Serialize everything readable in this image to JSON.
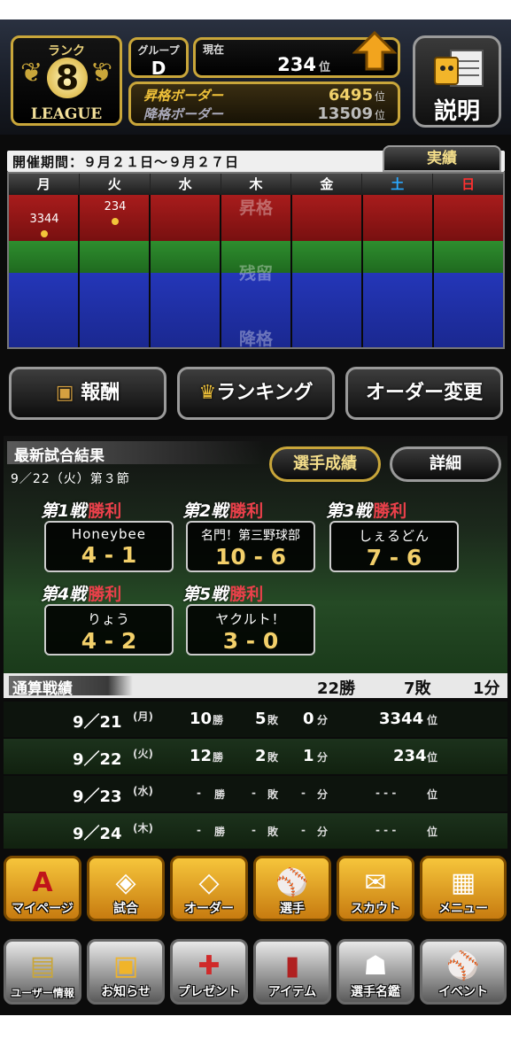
{
  "rank": {
    "label": "ランク",
    "number": "8",
    "league": "LEAGUE"
  },
  "group": {
    "label": "グループ",
    "value": "D"
  },
  "current": {
    "label": "現在",
    "value": "234",
    "unit": "位"
  },
  "promotion": {
    "label": "昇格ボーダー",
    "value": "6495",
    "unit": "位"
  },
  "demotion": {
    "label": "降格ボーダー",
    "value": "13509",
    "unit": "位"
  },
  "help_button": {
    "label": "説明",
    "icon": "league-book-icon"
  },
  "period": {
    "text": "開催期間：９月２１日〜９月２７日"
  },
  "performance_button": "実績",
  "calendar": {
    "days": [
      "月",
      "火",
      "水",
      "木",
      "金",
      "土",
      "日"
    ],
    "zones": {
      "promote": "昇格",
      "stay": "残留",
      "demote": "降格"
    },
    "values": [
      {
        "day": "月",
        "rank": "3344"
      },
      {
        "day": "火",
        "rank": "234"
      }
    ],
    "colors": {
      "promote": "#a81c1c",
      "stay": "#2e8e2e",
      "demote": "#2436b8",
      "saturday": "#2aa8ff",
      "sunday": "#ff3030"
    }
  },
  "nav": {
    "reward": "報酬",
    "ranking": "ランキング",
    "order_change": "オーダー変更"
  },
  "results": {
    "title": "最新試合結果",
    "date": "9／22（火）第３節",
    "player_stats_button": "選手成績",
    "detail_button": "詳細",
    "games": [
      {
        "num": "第1戦",
        "result": "勝利",
        "opponent": "Honeybee",
        "score": "4 - 1"
      },
      {
        "num": "第2戦",
        "result": "勝利",
        "opponent": "名門！第三野球部",
        "score": "10 - 6"
      },
      {
        "num": "第3戦",
        "result": "勝利",
        "opponent": "しぇるどん",
        "score": "7 - 6"
      },
      {
        "num": "第4戦",
        "result": "勝利",
        "opponent": "りょう",
        "score": "4 - 2"
      },
      {
        "num": "第5戦",
        "result": "勝利",
        "opponent": "ヤクルト！",
        "score": "3 - 0"
      }
    ]
  },
  "totals": {
    "label": "通算戦績",
    "wins": "22勝",
    "losses": "7敗",
    "draws": "1分"
  },
  "history": [
    {
      "date": "9／21",
      "dow": "(月)",
      "w": "10",
      "l": "5",
      "d": "0",
      "rank": "3344"
    },
    {
      "date": "9／22",
      "dow": "(火)",
      "w": "12",
      "l": "2",
      "d": "1",
      "rank": "234"
    },
    {
      "date": "9／23",
      "dow": "(水)",
      "w": "-",
      "l": "-",
      "d": "-",
      "rank": "- - -"
    },
    {
      "date": "9／24",
      "dow": "(木)",
      "w": "-",
      "l": "-",
      "d": "-",
      "rank": "- - -"
    }
  ],
  "units": {
    "win": "勝",
    "loss": "敗",
    "draw": "分",
    "rank": "位"
  },
  "menu1": [
    {
      "label": "マイページ",
      "icon": "mypage-a-icon"
    },
    {
      "label": "試合",
      "icon": "stadium-icon"
    },
    {
      "label": "オーダー",
      "icon": "field-order-icon"
    },
    {
      "label": "選手",
      "icon": "player-icon"
    },
    {
      "label": "スカウト",
      "icon": "scout-icon"
    },
    {
      "label": "メニュー",
      "icon": "menu-box-icon"
    }
  ],
  "menu2": [
    {
      "label": "ユーザー情報",
      "icon": "user-info-icon"
    },
    {
      "label": "お知らせ",
      "icon": "notice-icon"
    },
    {
      "label": "プレゼント",
      "icon": "present-icon"
    },
    {
      "label": "アイテム",
      "icon": "item-icon"
    },
    {
      "label": "選手名鑑",
      "icon": "player-directory-icon"
    },
    {
      "label": "イベント",
      "icon": "event-icon"
    }
  ]
}
